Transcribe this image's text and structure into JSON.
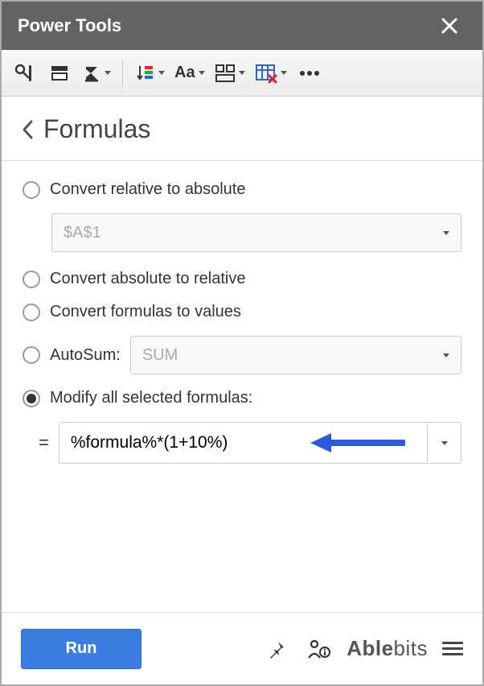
{
  "titlebar": {
    "title": "Power Tools"
  },
  "page": {
    "title": "Formulas"
  },
  "options": {
    "convert_rel_to_abs": {
      "label": "Convert relative to absolute",
      "dropdown_value": "$A$1"
    },
    "convert_abs_to_rel": {
      "label": "Convert absolute to relative"
    },
    "convert_to_values": {
      "label": "Convert formulas to values"
    },
    "autosum": {
      "label": "AutoSum:",
      "dropdown_value": "SUM"
    },
    "modify_all": {
      "label": "Modify all selected formulas:",
      "input_value": "%formula%*(1+10%)"
    }
  },
  "footer": {
    "run_label": "Run",
    "brand": "Ablebits"
  }
}
